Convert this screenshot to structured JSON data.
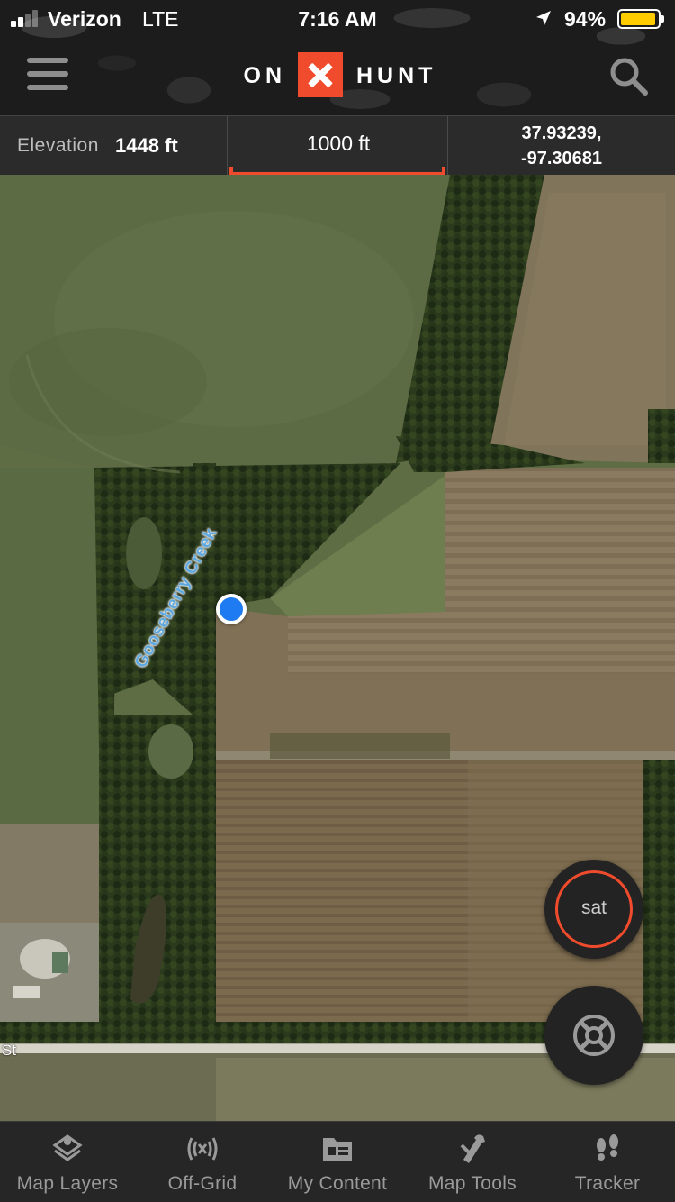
{
  "status_bar": {
    "carrier": "Verizon",
    "network": "LTE",
    "time": "7:16 AM",
    "battery_percent_label": "94%",
    "battery_level": 0.94,
    "signal_bars": 2
  },
  "header": {
    "brand_left": "ON",
    "brand_right": "HUNT",
    "brand_color": "#f04b2c",
    "menu_icon": "hamburger-menu-icon",
    "search_icon": "search-icon"
  },
  "info_bar": {
    "elevation_label": "Elevation",
    "elevation_value": "1448 ft",
    "scale_value": "1000 ft",
    "latitude": "37.93239,",
    "longitude": "-97.30681"
  },
  "map": {
    "creek_label": "Gooseberry Creek",
    "road_label": "St",
    "layer_button_label": "sat",
    "recenter_icon": "gps-target-icon"
  },
  "tabs": [
    {
      "label": "Map Layers",
      "icon": "map-layers-icon"
    },
    {
      "label": "Off-Grid",
      "icon": "off-grid-icon"
    },
    {
      "label": "My Content",
      "icon": "folder-icon"
    },
    {
      "label": "Map Tools",
      "icon": "map-tools-icon"
    },
    {
      "label": "Tracker",
      "icon": "footprints-icon"
    }
  ]
}
